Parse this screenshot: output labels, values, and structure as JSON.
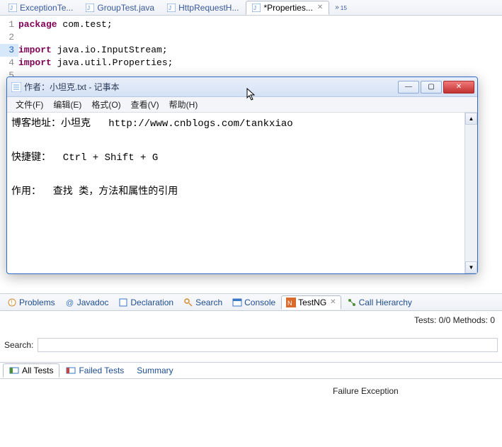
{
  "editor_tabs": {
    "items": [
      {
        "label": "ExceptionTe..."
      },
      {
        "label": "GroupTest.java"
      },
      {
        "label": "HttpRequestH..."
      },
      {
        "label": "*Properties..."
      }
    ],
    "overflow": "15"
  },
  "code": {
    "lines": [
      {
        "n": "1",
        "tokens": [
          [
            "kw",
            "package"
          ],
          [
            "plain",
            " com.test;"
          ]
        ]
      },
      {
        "n": "2",
        "tokens": []
      },
      {
        "n": "3",
        "mark": true,
        "tokens": [
          [
            "kw",
            "import"
          ],
          [
            "plain",
            " java.io.InputStream;"
          ]
        ]
      },
      {
        "n": "4",
        "tokens": [
          [
            "kw",
            "import"
          ],
          [
            "plain",
            " java.util.Properties;"
          ]
        ]
      },
      {
        "n": "5",
        "tokens": []
      }
    ]
  },
  "notepad": {
    "title": "作者：小坦克.txt - 记事本",
    "menu": {
      "file": "文件(F)",
      "edit": "编辑(E)",
      "format": "格式(O)",
      "view": "查看(V)",
      "help": "帮助(H)"
    },
    "content_line1": "博客地址：小坦克   http://www.cnblogs.com/tankxiao",
    "content_line2": "快捷键：  Ctrl + Shift + G",
    "content_line3": "作用：  查找 类，方法和属性的引用"
  },
  "views": {
    "problems": "Problems",
    "javadoc": "Javadoc",
    "declaration": "Declaration",
    "search": "Search",
    "console": "Console",
    "testng": "TestNG",
    "call_hierarchy": "Call Hierarchy"
  },
  "testng": {
    "status": "Tests: 0/0  Methods: 0",
    "search_label": "Search:",
    "search_value": "",
    "tabs": {
      "all": "All Tests",
      "failed": "Failed Tests",
      "summary": "Summary"
    },
    "failure_label": "Failure Exception"
  }
}
